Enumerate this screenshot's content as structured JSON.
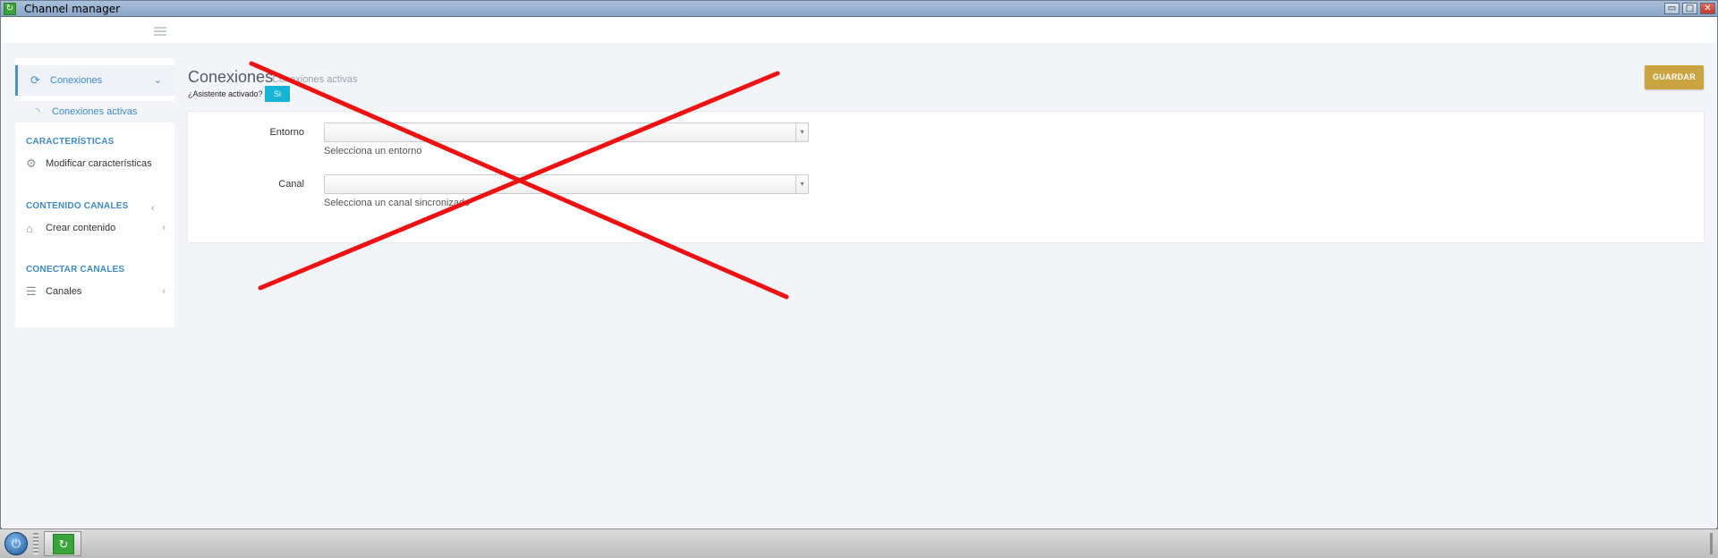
{
  "window": {
    "title": "Channel manager",
    "app_icon": "refresh-icon",
    "controls": {
      "minimize": "▭",
      "maximize": "□",
      "close": "✕"
    }
  },
  "sidebar": {
    "main_item": {
      "label": "Conexiones",
      "icon": "refresh-icon"
    },
    "sub_item": {
      "label": "Conexiones activas",
      "icon": "rss-icon"
    },
    "sections": [
      {
        "heading": "CARACTERÍSTICAS",
        "item": {
          "label": "Modificar características",
          "icon": "gear-icon"
        }
      },
      {
        "heading": "CONTENIDO CANALES",
        "item": {
          "label": "Crear contenido",
          "icon": "home-icon"
        }
      },
      {
        "heading": "CONECTAR CANALES",
        "item": {
          "label": "Canales",
          "icon": "list-icon"
        }
      }
    ]
  },
  "header": {
    "title": "Conexiones",
    "subtitle": "Conexiones activas",
    "wizard_label": "¿Asistente activado?",
    "wizard_value": "Si",
    "save_label": "GUARDAR"
  },
  "form": {
    "fields": [
      {
        "label": "Entorno",
        "value": "",
        "help": "Selecciona un entorno"
      },
      {
        "label": "Canal",
        "value": "",
        "help": "Selecciona un canal sincronizado"
      }
    ]
  },
  "overlay": {
    "type": "red-x-cross",
    "color": "#ee1111"
  },
  "colors": {
    "accent": "#3d8bc8",
    "save": "#c9a441",
    "wizard": "#15b4d6"
  }
}
